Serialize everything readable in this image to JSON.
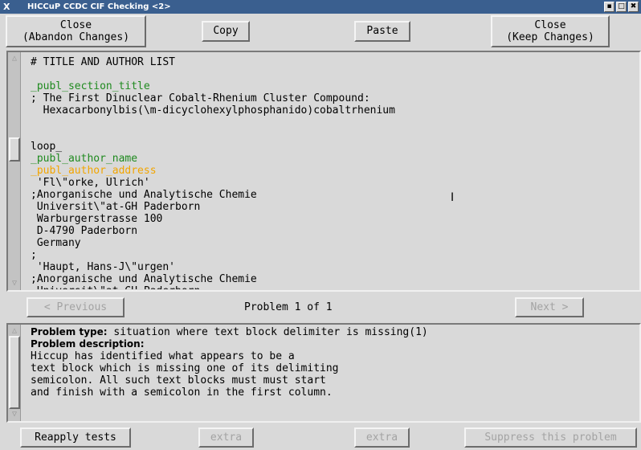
{
  "window": {
    "title": "HICCuP  CCDC CIF Checking <2>",
    "logo": "X",
    "controls": [
      "▪",
      "□",
      "✖"
    ]
  },
  "toolbar": {
    "close_abandon": [
      "Close",
      "(Abandon Changes)"
    ],
    "copy": "Copy",
    "paste": "Paste",
    "close_keep": [
      "Close",
      "(Keep Changes)"
    ]
  },
  "editor": {
    "lines": [
      {
        "text": "# TITLE AND AUTHOR LIST",
        "style": "plain"
      },
      {
        "text": "",
        "style": "plain"
      },
      {
        "text": "_publ_section_title",
        "style": "green"
      },
      {
        "text": "; The First Dinuclear Cobalt-Rhenium Cluster Compound:",
        "style": "plain"
      },
      {
        "text": "  Hexacarbonylbis(\\m-dicyclohexylphosphanido)cobaltrhenium",
        "style": "plain"
      },
      {
        "text": "",
        "style": "plain"
      },
      {
        "text": "",
        "style": "plain"
      },
      {
        "text": "loop_",
        "style": "plain"
      },
      {
        "text": "_publ_author_name",
        "style": "green"
      },
      {
        "text": "_publ_author_address",
        "style": "orange"
      },
      {
        "text": " 'Fl\\\"orke, Ulrich'",
        "style": "plain"
      },
      {
        "text": ";Anorganische und Analytische Chemie",
        "style": "plain"
      },
      {
        "text": " Universit\\\"at-GH Paderborn",
        "style": "plain"
      },
      {
        "text": " Warburgerstrasse 100",
        "style": "plain"
      },
      {
        "text": " D-4790 Paderborn",
        "style": "plain"
      },
      {
        "text": " Germany",
        "style": "plain"
      },
      {
        "text": ";",
        "style": "plain"
      },
      {
        "text": " 'Haupt, Hans-J\\\"urgen'",
        "style": "plain"
      },
      {
        "text": ";Anorganische und Analytische Chemie",
        "style": "plain"
      },
      {
        "text": " Universit\\\"at-GH Paderborn",
        "style": "plain"
      }
    ]
  },
  "nav": {
    "previous": "<  Previous",
    "problem_label": "Problem  1 of 1",
    "next": "Next  >"
  },
  "problem": {
    "type_label": "Problem type:",
    "type_value": " situation where text block delimiter is missing(1)",
    "desc_label": "Problem description:",
    "desc_lines": [
      "Hiccup has identified what appears to be a",
      "text block which is missing one of its delimiting",
      "semicolon. All such text blocks must must start",
      "and finish with a semicolon in the first column."
    ]
  },
  "bottom": {
    "reapply": "Reapply tests",
    "extra1": "extra",
    "extra2": "extra",
    "suppress": "Suppress this problem"
  },
  "colors": {
    "titlebar": "#3a5f8f",
    "cif_tag_green": "#1f8a1f",
    "cif_tag_highlight": "#f2a500",
    "disabled_text": "#a3a3a3"
  }
}
